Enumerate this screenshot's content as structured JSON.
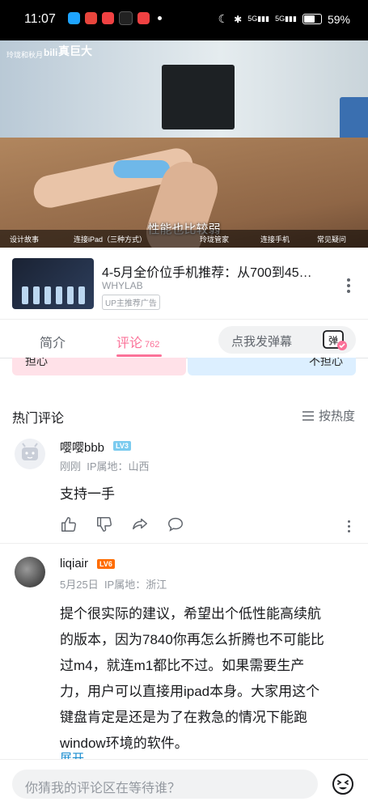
{
  "status_bar": {
    "time": "11:07",
    "battery": "59%",
    "network1": "5G",
    "network2": "5G"
  },
  "video": {
    "uploader_watermark": "玲珑和秋月",
    "title": "真巨大",
    "subtitle": "性能也比较弱",
    "chapters": [
      "设计故事",
      "连接iPad（三种方式）",
      "玲珑管家",
      "连接手机",
      "常见疑问"
    ]
  },
  "ad": {
    "title": "4-5月全价位手机推荐：从700到45…",
    "author": "WHYLAB",
    "tag": "UP主推荐广告"
  },
  "tabs": {
    "intro": "简介",
    "comments": "评论",
    "comments_count": "762",
    "danmu_placeholder": "点我发弹幕",
    "danmu_button": "弹"
  },
  "vote": {
    "left_label": "担心",
    "right_label": "不担心"
  },
  "comments_section": {
    "header": "热门评论",
    "sort_label": "按热度",
    "items": [
      {
        "username": "嘤嘤bbb",
        "level": "LV3",
        "time": "刚刚",
        "ip": "IP属地：山西",
        "text": "支持一手"
      },
      {
        "username": "liqiair",
        "level": "LV6",
        "time": "5月25日",
        "ip": "IP属地：浙江",
        "text_lines": [
          "提个很实际的建议，希望出个低性能高续航",
          "的版本，因为7840你再怎么折腾也不可能比",
          "过m4，就连m1都比不过。如果需要生产",
          "力，用户可以直接用ipad本身。大家用这个",
          "键盘肯定是还是为了在救急的情况下能跑",
          "window环境的软件。"
        ],
        "expand": "展开"
      }
    ]
  },
  "bottom": {
    "reply_placeholder": "你猜我的评论区在等待谁？"
  },
  "colors": {
    "accent": "#fb7299",
    "lv3": "#7bcbef",
    "lv6": "#ff6c00",
    "link": "#178bcf"
  }
}
